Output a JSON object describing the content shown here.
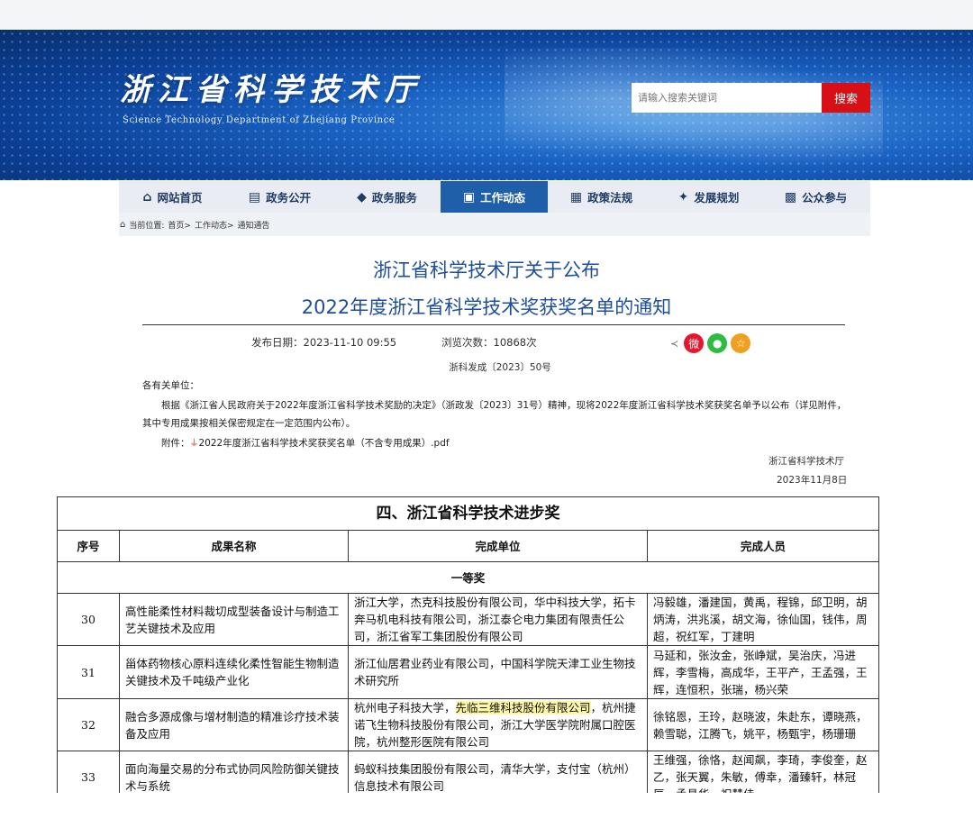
{
  "header": {
    "title": "浙江省科学技术厅",
    "subtitle": "Science Technology Department of Zhejiang Province",
    "search_placeholder": "请输入搜索关键词",
    "search_button": "搜索"
  },
  "nav": {
    "items": [
      {
        "label": "网站首页",
        "icon": "home-icon"
      },
      {
        "label": "政务公开",
        "icon": "list-icon"
      },
      {
        "label": "政务服务",
        "icon": "chat-icon"
      },
      {
        "label": "工作动态",
        "icon": "news-icon",
        "active": true
      },
      {
        "label": "政策法规",
        "icon": "document-icon"
      },
      {
        "label": "发展规划",
        "icon": "handshake-icon"
      },
      {
        "label": "公众参与",
        "icon": "people-icon"
      }
    ]
  },
  "breadcrumb": {
    "prefix": "当前位置:",
    "home": "首页>",
    "section": "工作动态>",
    "current": "通知通告"
  },
  "article": {
    "title_line1": "浙江省科学技术厅关于公布",
    "title_line2": "2022年度浙江省科学技术奖获奖名单的通知",
    "publish_date": "发布日期：2023-11-10 09:55",
    "views": "浏览次数：10868次",
    "doc_number": "浙科发成〔2023〕50号",
    "salutation": "各有关单位：",
    "body_line1": "根据《浙江省人民政府关于2022年度浙江省科学技术奖励的决定》（浙政发〔2023〕31号）精神，现将2022年度浙江省科学技术奖获奖名单予以公布（详见附件，",
    "body_line2": "其中专用成果按相关保密规定在一定范围内公布）。",
    "attachment_label": "附件：",
    "attachment_file": "2022年度浙江省科学技术奖获奖名单（不含专用成果）.pdf",
    "signature_org": "浙江省科学技术厅",
    "signature_date": "2023年11月8日"
  },
  "share": {
    "icons": [
      "share-icon",
      "weibo-icon",
      "wechat-icon",
      "favorite-icon"
    ],
    "colors": [
      "#e6162d",
      "#2dbb40",
      "#f0a020"
    ]
  },
  "award_table": {
    "caption": "四、浙江省科学技术进步奖",
    "headers": [
      "序号",
      "成果名称",
      "完成单位",
      "完成人员"
    ],
    "level": "一等奖",
    "rows": [
      {
        "no": "30",
        "name": "高性能柔性材料裁切成型装备设计与制造工艺关键技术及应用",
        "units": "浙江大学，杰克科技股份有限公司，华中科技大学，拓卡奔马机电科技有限公司，浙江泰仑电力集团有限责任公司，浙江省军工集团股份有限公司",
        "people": "冯毅雄，潘建国，黄禹，程锦，邱卫明，胡炳涛，洪兆溪，胡文海，徐仙国，钱伟，周超，祝红军，丁建明"
      },
      {
        "no": "31",
        "name": "甾体药物核心原料连续化柔性智能生物制造关键技术及千吨级产业化",
        "units": "浙江仙居君业药业有限公司，中国科学院天津工业生物技术研究所",
        "people": "马延和，张汝金，张峥斌，吴治庆，冯进辉，李雪梅，高成华，王平产，王孟强，王辉，连恒积，张瑞，杨兴荣"
      },
      {
        "no": "32",
        "name": "融合多源成像与增材制造的精准诊疗技术装备及应用",
        "units_before": "杭州电子科技大学，",
        "units_highlight": "先临三维科技股份有限公司",
        "units_after": "，杭州捷诺飞生物科技股份有限公司，浙江大学医学院附属口腔医院，杭州整形医院有限公司",
        "people": "徐铭恩，王玲，赵晓波，朱赴东，谭晓燕，赖雪聪，江腾飞，姚平，杨甄宇，杨珊珊"
      },
      {
        "no": "33",
        "name": "面向海量交易的分布式协同风险防御关键技术与系统",
        "units": "蚂蚁科技集团股份有限公司，清华大学，支付宝（杭州）信息技术有限公司",
        "people": "王维强，徐恪，赵闻飙，李琦，李俊奎，赵乙，张天翼，朱敏，傅幸，潘臻轩，林冠辰，孟昌华，祝慧佳"
      }
    ]
  }
}
